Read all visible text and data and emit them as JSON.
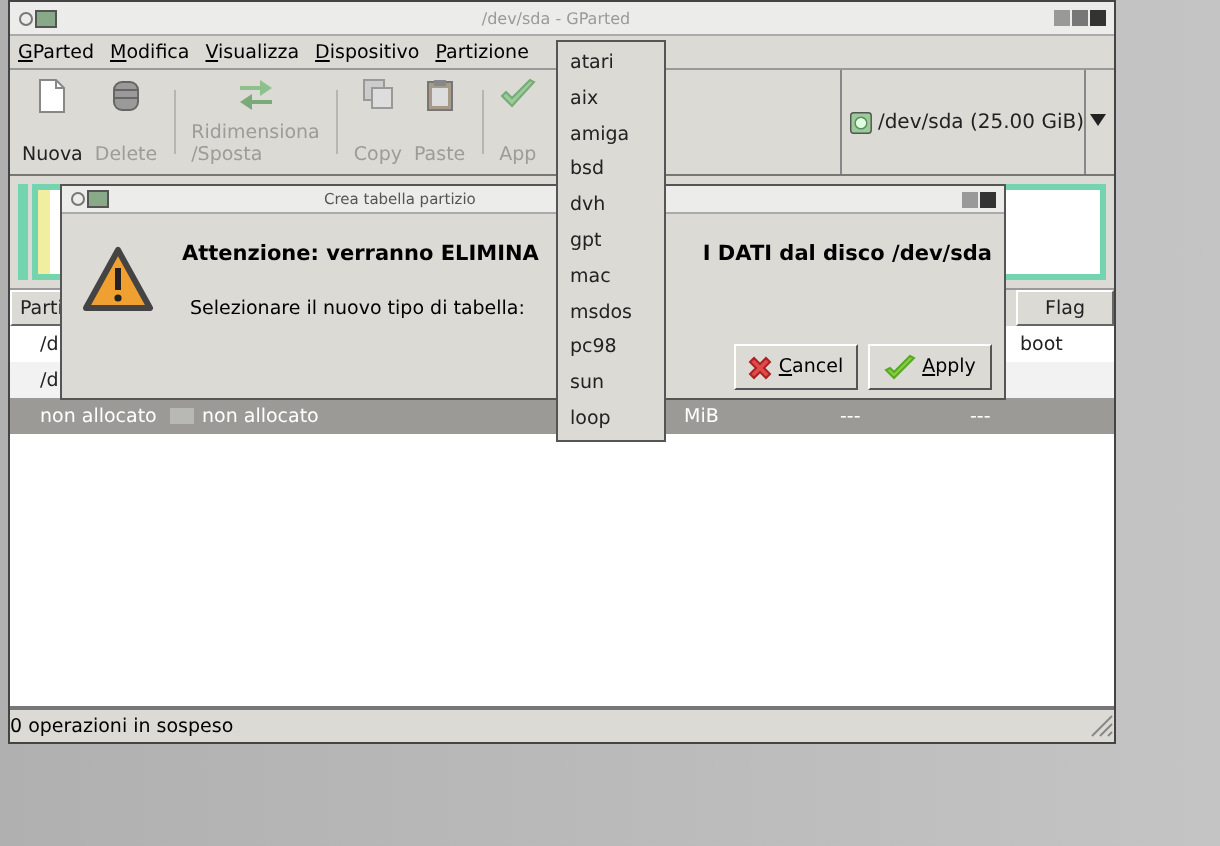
{
  "window": {
    "title": "/dev/sda - GParted"
  },
  "menubar": [
    {
      "label": "GParted"
    },
    {
      "label": "Modifica"
    },
    {
      "label": "Visualizza"
    },
    {
      "label": "Dispositivo"
    },
    {
      "label": "Partizione"
    }
  ],
  "toolbar": [
    {
      "label": "Nuova",
      "disabled": false
    },
    {
      "label": "Delete",
      "disabled": true
    },
    {
      "kind": "separator"
    },
    {
      "label": "Ridimensiona\n/Sposta",
      "disabled": true
    },
    {
      "kind": "separator"
    },
    {
      "label": "Copy",
      "disabled": true
    },
    {
      "label": "Paste",
      "disabled": true
    },
    {
      "kind": "separator"
    },
    {
      "label": "App",
      "disabled": true
    }
  ],
  "device": {
    "label": "/dev/sda  (25.00 GiB)"
  },
  "table": {
    "header": {
      "column_1": "Parti",
      "flag": "Flag"
    },
    "rows": [
      {
        "column_1": "/d",
        "flag": "boot",
        "selected": false
      },
      {
        "column_1": "/d",
        "selected": false
      },
      {
        "column_1": "non allocato",
        "column_2": "non allocato",
        "column_3": "MiB",
        "column_4": "---",
        "column_5": "---",
        "selected": true
      }
    ]
  },
  "status_bar": "0 operazioni in sospeso",
  "dialog": {
    "title": "Crea tabella partizio",
    "heading_start": "Attenzione: verranno ELIMINA",
    "heading_end": "I DATI dal disco /dev/sda",
    "prompt": "Selezionare il nuovo tipo di tabella:",
    "buttons": [
      {
        "kind": "cancel",
        "label": "Cancel"
      },
      {
        "kind": "apply",
        "label": "Apply"
      }
    ]
  },
  "dropdown": {
    "items": [
      "atari",
      "aix",
      "amiga",
      "bsd",
      "dvh",
      "gpt",
      "mac",
      "msdos",
      "pc98",
      "sun",
      "loop"
    ]
  }
}
